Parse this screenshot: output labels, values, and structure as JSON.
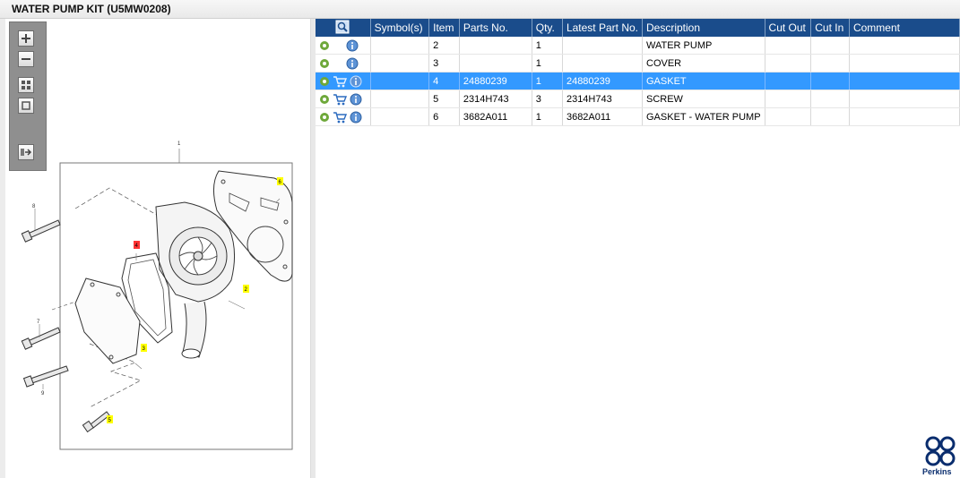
{
  "window": {
    "title": "WATER PUMP KIT (U5MW0208)"
  },
  "zoom_toolbar": {
    "buttons": [
      "zoom-in",
      "zoom-out",
      "fit-all",
      "actual-size",
      "next-page"
    ]
  },
  "diagram": {
    "callouts": [
      "1",
      "2",
      "3",
      "4",
      "5",
      "6",
      "7",
      "8",
      "9"
    ],
    "highlighted_callouts": [
      "2",
      "3",
      "5",
      "6"
    ],
    "selected_callout": "4"
  },
  "parts_table": {
    "headers": [
      "",
      "Symbol(s)",
      "Item",
      "Parts No.",
      "Qty.",
      "Latest Part No.",
      "Description",
      "Cut Out",
      "Cut In",
      "Comment"
    ],
    "rows": [
      {
        "item": "2",
        "parts_no": "",
        "qty": "1",
        "latest_part_no": "",
        "description": "WATER PUMP",
        "cut_out": "",
        "cut_in": "",
        "comment": "",
        "has_cart": false,
        "selected": false
      },
      {
        "item": "3",
        "parts_no": "",
        "qty": "1",
        "latest_part_no": "",
        "description": "COVER",
        "cut_out": "",
        "cut_in": "",
        "comment": "",
        "has_cart": false,
        "selected": false
      },
      {
        "item": "4",
        "parts_no": "24880239",
        "qty": "1",
        "latest_part_no": "24880239",
        "description": "GASKET",
        "cut_out": "",
        "cut_in": "",
        "comment": "",
        "has_cart": true,
        "selected": true
      },
      {
        "item": "5",
        "parts_no": "2314H743",
        "qty": "3",
        "latest_part_no": "2314H743",
        "description": "SCREW",
        "cut_out": "",
        "cut_in": "",
        "comment": "",
        "has_cart": true,
        "selected": false
      },
      {
        "item": "6",
        "parts_no": "3682A011",
        "qty": "1",
        "latest_part_no": "3682A011",
        "description": "GASKET - WATER PUMP",
        "cut_out": "",
        "cut_in": "",
        "comment": "",
        "has_cart": true,
        "selected": false
      }
    ]
  },
  "brand": {
    "name": "Perkins",
    "color": "#0a2d6e"
  },
  "colors": {
    "header_bg": "#1a4c8b",
    "selected_row": "#3399ff",
    "callout_highlight": "#ffff00",
    "callout_selected": "#ff0000"
  },
  "icons": {
    "row_settings": "gear-icon",
    "row_info": "info-icon",
    "row_cart": "cart-icon",
    "header_search": "search-icon"
  }
}
